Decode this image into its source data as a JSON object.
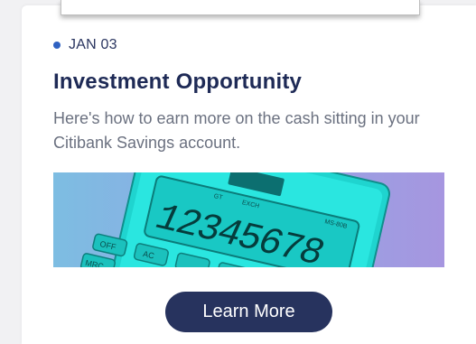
{
  "article": {
    "date": "JAN 03",
    "title": "Investment Opportunity",
    "description": "Here's how to earn more on the cash sitting in your Citibank Savings account.",
    "cta_label": "Learn More"
  },
  "image": {
    "display_digits": "12345678",
    "keys": [
      "OFF",
      "AC",
      "MRC"
    ],
    "display_labels": [
      "GT",
      "EXCH",
      "MS-80B"
    ]
  },
  "colors": {
    "accent_dot": "#2f62c2",
    "title": "#1e2a56",
    "button_bg": "#27335e",
    "calculator": "#22e0dc"
  }
}
